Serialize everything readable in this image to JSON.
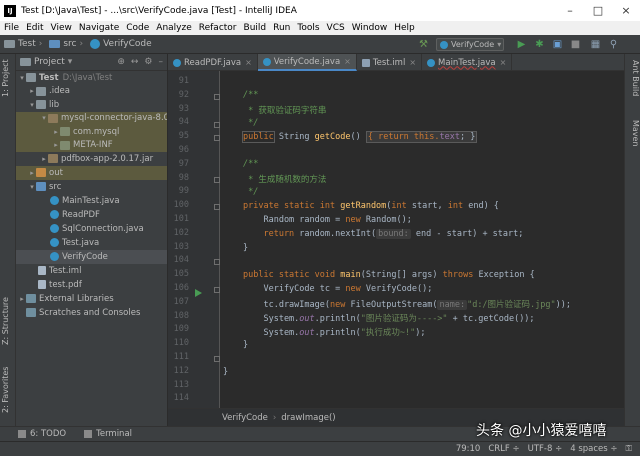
{
  "window": {
    "title": "Test [D:\\Java\\Test] - ...\\src\\VerifyCode.java [Test] - IntelliJ IDEA",
    "icon": "intellij-icon"
  },
  "menu": [
    "File",
    "Edit",
    "View",
    "Navigate",
    "Code",
    "Analyze",
    "Refactor",
    "Build",
    "Run",
    "Tools",
    "VCS",
    "Window",
    "Help"
  ],
  "nav": {
    "project": "Test",
    "folder": "src",
    "file": "VerifyCode",
    "run_config": "VerifyCode"
  },
  "left_strip": {
    "project_tab": "1: Project",
    "structure_tab": "Z: Structure",
    "favorites_tab": "2: Favorites"
  },
  "right_strip": {
    "ant_tab": "Ant Build",
    "maven_tab": "Maven"
  },
  "project_panel": {
    "header": "Project",
    "tree": [
      {
        "label": "Test",
        "path": "D:\\Java\\Test"
      },
      {
        "label": ".idea"
      },
      {
        "label": "lib"
      },
      {
        "label": "mysql-connector-java-8.0.1"
      },
      {
        "label": "com.mysql"
      },
      {
        "label": "META-INF"
      },
      {
        "label": "pdfbox-app-2.0.17.jar"
      },
      {
        "label": "out"
      },
      {
        "label": "src"
      },
      {
        "label": "MainTest.java"
      },
      {
        "label": "ReadPDF"
      },
      {
        "label": "SqlConnection.java"
      },
      {
        "label": "Test.java"
      },
      {
        "label": "VerifyCode"
      },
      {
        "label": "Test.iml"
      },
      {
        "label": "test.pdf"
      },
      {
        "label": "External Libraries"
      },
      {
        "label": "Scratches and Consoles"
      }
    ]
  },
  "tabs": [
    {
      "label": "ReadPDF.java",
      "x": "×"
    },
    {
      "label": "VerifyCode.java",
      "x": "×"
    },
    {
      "label": "Test.iml",
      "x": "×"
    },
    {
      "label": "MainTest.java",
      "x": "×"
    }
  ],
  "code": {
    "line_numbers": [
      "91",
      "92",
      "93",
      "94",
      "95",
      "96",
      "97",
      "98",
      "99",
      "100",
      "101",
      "102",
      "103",
      "104",
      "105",
      "106",
      "107",
      "108",
      "109",
      "110",
      "111",
      "112",
      "113",
      "114"
    ],
    "l92": "/**",
    "l93": " * 获取验证码字符串",
    "l94": " */",
    "l95_kw": "public",
    "l95_type": " String ",
    "l95_fn": "getCode",
    "l95_paren": "() ",
    "l95_body_kw": "{ return this.",
    "l95_field": "text",
    "l95_end": "; }",
    "l97": "/**",
    "l98": " * 生成随机数的方法",
    "l99": " */",
    "l100_kw": "private static int ",
    "l100_fn": "getRandom",
    "l100_args_a": "(",
    "l100_args_kw1": "int",
    "l100_args_b": " start, ",
    "l100_args_kw2": "int",
    "l100_args_c": " end) {",
    "l101_a": "    Random random = ",
    "l101_kw": "new",
    "l101_b": " Random();",
    "l102_kw": "    return",
    "l102_a": " random.nextInt(",
    "l102_hint": "bound:",
    "l102_b": " end - start) + start;",
    "l103": "}",
    "l105_kw": "public static void ",
    "l105_fn": "main",
    "l105_a": "(String[] args) ",
    "l105_kw2": "throws",
    "l105_b": " Exception {",
    "l106_a": "    VerifyCode tc = ",
    "l106_kw": "new",
    "l106_b": " VerifyCode();",
    "l107_a": "    tc.drawImage(",
    "l107_kw": "new",
    "l107_b": " FileOutputStream(",
    "l107_hint": "name:",
    "l107_str": "\"d:/图片验证码.jpg\"",
    "l107_c": "));",
    "l108_a": "    System.",
    "l108_out": "out",
    "l108_b": ".println(",
    "l108_str": "\"图片验证码为---->\"",
    "l108_c": " + tc.getCode());",
    "l109_a": "    System.",
    "l109_out": "out",
    "l109_b": ".println(",
    "l109_str": "\"执行成功~!\"",
    "l109_c": ");",
    "l110": "}",
    "l112": "}"
  },
  "editor_breadcrumb": {
    "class": "VerifyCode",
    "method": "drawImage()"
  },
  "bottom_tools": {
    "todo": "6: TODO",
    "terminal": "Terminal"
  },
  "status": {
    "position": "79:10",
    "line_sep": "CRLF ÷",
    "encoding": "UTF-8 ÷",
    "indent": "4 spaces ÷"
  },
  "watermark": "头条 @小小猿爱嘻嘻"
}
